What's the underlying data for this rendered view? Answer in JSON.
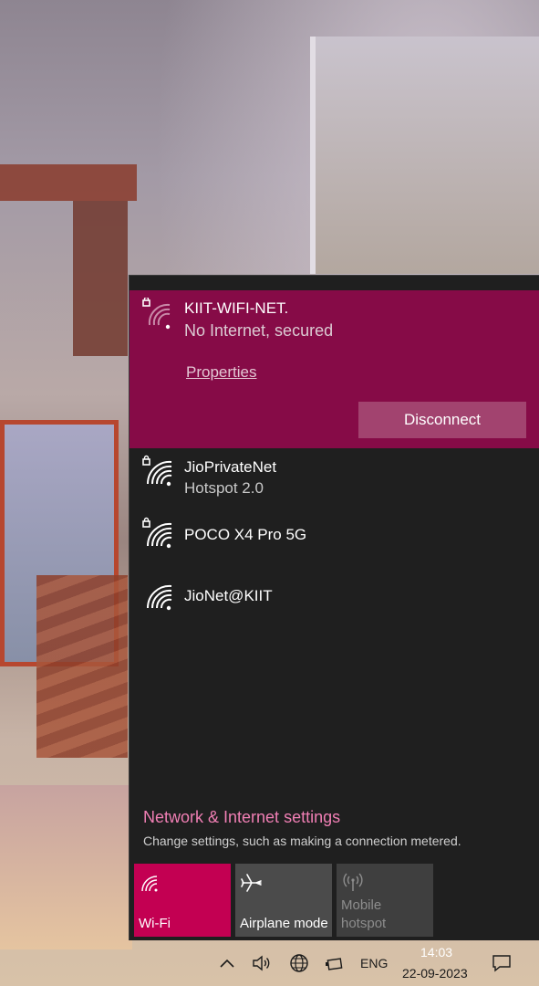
{
  "networks": {
    "connected": {
      "name": "KIIT-WIFI-NET.",
      "status": "No Internet, secured",
      "properties_label": "Properties",
      "disconnect_label": "Disconnect",
      "icon": "wifi-secured-warning-icon"
    },
    "available": [
      {
        "name": "JioPrivateNet",
        "status": "Hotspot 2.0",
        "icon": "wifi-secured-icon"
      },
      {
        "name": "POCO X4 Pro 5G",
        "status": "",
        "icon": "wifi-secured-icon"
      },
      {
        "name": "JioNet@KIIT",
        "status": "",
        "icon": "wifi-open-icon"
      }
    ]
  },
  "settings": {
    "link_label": "Network & Internet settings",
    "description": "Change settings, such as making a connection metered."
  },
  "quick_actions": [
    {
      "label": "Wi-Fi",
      "icon": "wifi-icon",
      "state": "on"
    },
    {
      "label": "Airplane mode",
      "icon": "airplane-icon",
      "state": "off"
    },
    {
      "label": "Mobile hotspot",
      "label_line1": "Mobile",
      "label_line2": "hotspot",
      "icon": "hotspot-icon",
      "state": "disabled"
    }
  ],
  "taskbar": {
    "language": "ENG",
    "time": "14:03",
    "date": "22-09-2023"
  },
  "colors": {
    "accent": "#860b47",
    "accent_tile": "#c30052",
    "link": "#f07fb4",
    "flyout_bg": "#1f1f1f"
  }
}
